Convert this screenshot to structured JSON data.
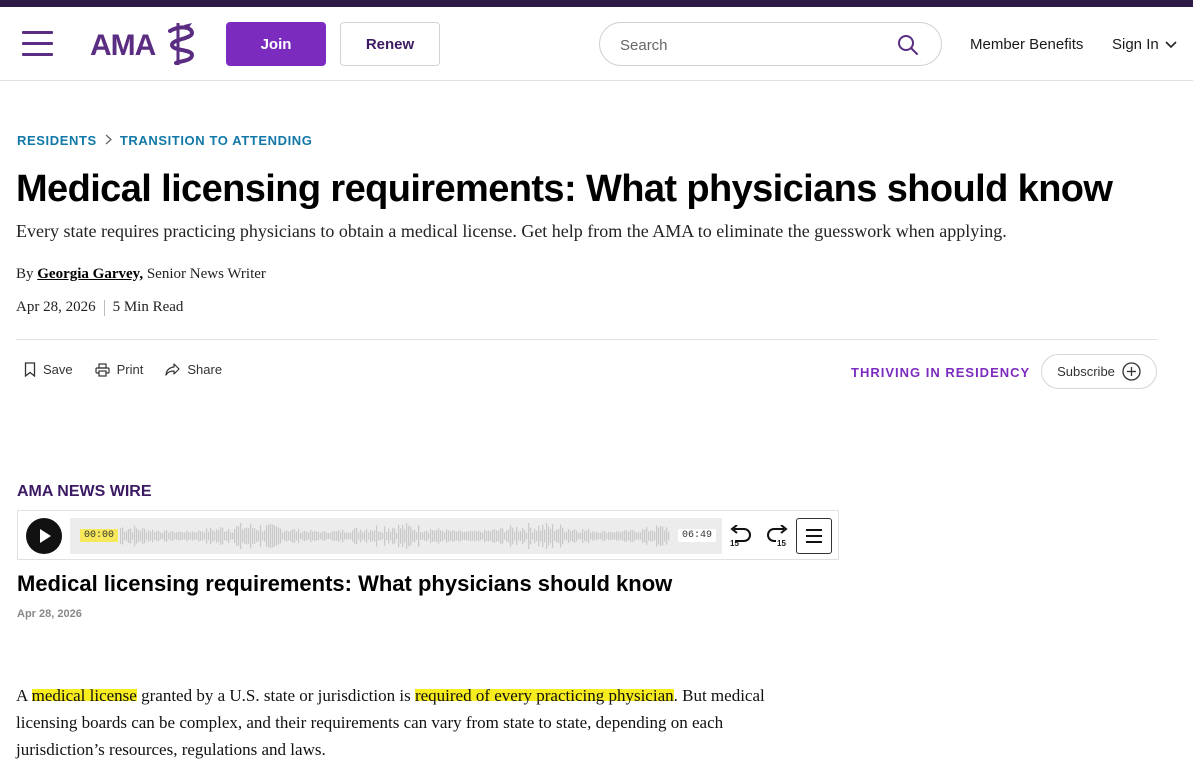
{
  "header": {
    "logo_text": "AMA",
    "join_label": "Join",
    "renew_label": "Renew",
    "search_placeholder": "Search",
    "member_benefits": "Member Benefits",
    "sign_in": "Sign In"
  },
  "breadcrumb": {
    "items": [
      "RESIDENTS",
      "TRANSITION TO ATTENDING"
    ]
  },
  "article": {
    "title": "Medical licensing requirements: What physicians should know",
    "subtitle": "Every state requires practicing physicians to obtain a medical license. Get help from the AMA to eliminate the guesswork when applying.",
    "by": "By",
    "author": "Georgia Garvey,",
    "author_role": "Senior News Writer",
    "date": "Apr 28, 2026",
    "read_time": "5 Min Read"
  },
  "actions": {
    "save": "Save",
    "print": "Print",
    "share": "Share",
    "series": "THRIVING IN RESIDENCY",
    "subscribe": "Subscribe"
  },
  "player": {
    "section_label": "AMA NEWS WIRE",
    "current_time": "00:00",
    "total_time": "06:49",
    "skip_seconds": "15",
    "title": "Medical licensing requirements: What physicians should know",
    "date": "Apr 28, 2026"
  },
  "body": {
    "p1_a": "A ",
    "p1_hl1": "medical license",
    "p1_b": " granted by a U.S. state or jurisdiction is ",
    "p1_hl2": "required of every practicing physician",
    "p1_c": ". But medical licensing boards can be complex, and their requirements can vary from state to state, depending on each jurisdiction’s resources, regulations and laws."
  },
  "colors": {
    "brand_purple": "#5a2d82",
    "join_purple": "#7b2cbf",
    "breadcrumb_blue": "#1278a8",
    "highlight_yellow": "#f7ec1e"
  }
}
